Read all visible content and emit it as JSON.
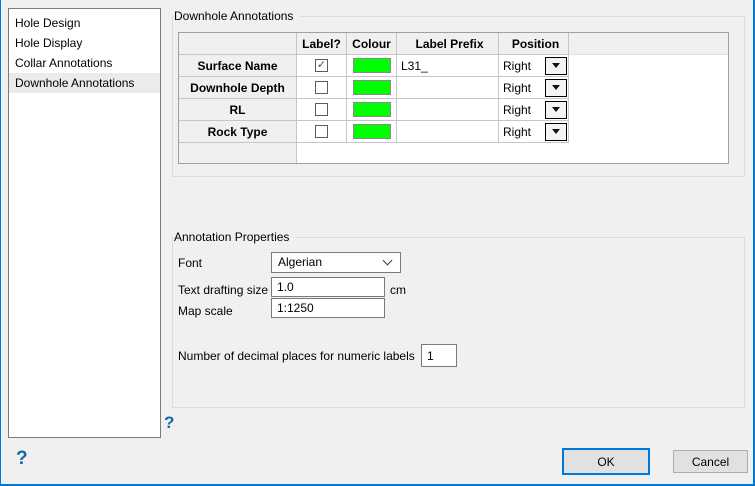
{
  "window": {
    "accent_border_color": "#0078d7",
    "background_color": "#f0f0f0"
  },
  "sidebar": {
    "items": [
      {
        "label": "Hole Design",
        "selected": false
      },
      {
        "label": "Hole Display",
        "selected": false
      },
      {
        "label": "Collar Annotations",
        "selected": false
      },
      {
        "label": "Downhole Annotations",
        "selected": true
      }
    ]
  },
  "downhole_group": {
    "title": "Downhole Annotations",
    "table": {
      "columns": [
        "",
        "Label?",
        "Colour",
        "Label Prefix",
        "Position"
      ],
      "rows": [
        {
          "name": "Surface Name",
          "label_checked": true,
          "colour": "#00ff00",
          "label_prefix": "L31_",
          "position": "Right"
        },
        {
          "name": "Downhole Depth",
          "label_checked": false,
          "colour": "#00ff00",
          "label_prefix": "",
          "position": "Right"
        },
        {
          "name": "RL",
          "label_checked": false,
          "colour": "#00ff00",
          "label_prefix": "",
          "position": "Right"
        },
        {
          "name": "Rock Type",
          "label_checked": false,
          "colour": "#00ff00",
          "label_prefix": "",
          "position": "Right"
        }
      ],
      "check_glyph": "✓"
    }
  },
  "properties_group": {
    "title": "Annotation Properties",
    "font_label": "Font",
    "font_value": "Algerian",
    "text_size_label": "Text drafting size",
    "text_size_value": "1.0",
    "text_size_unit": "cm",
    "map_scale_label": "Map scale",
    "map_scale_value": "1:1250",
    "decimals_label": "Number of decimal places for numeric labels",
    "decimals_value": "1"
  },
  "help": {
    "icon": "?",
    "color": "#1767a0"
  },
  "buttons": {
    "ok": "OK",
    "cancel": "Cancel"
  }
}
